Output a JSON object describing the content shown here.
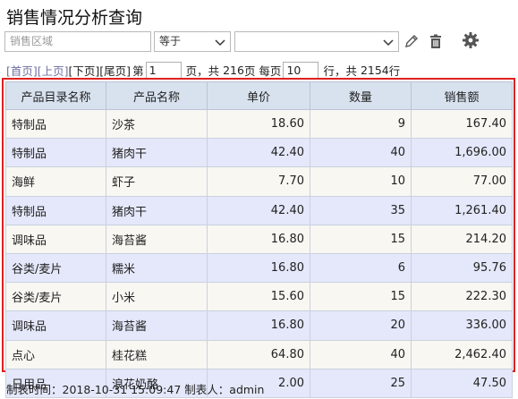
{
  "title": "销售情况分析查询",
  "filter": {
    "region_placeholder": "销售区域",
    "operator": "等于",
    "value": ""
  },
  "icons": {
    "edit": "pencil-icon",
    "delete": "trash-icon",
    "settings": "gear-icon"
  },
  "pager": {
    "first": "[首页]",
    "prev": "[上页]",
    "next": "[下页]",
    "last": "[尾页]",
    "page_prefix": "第",
    "page": "1",
    "page_suffix": "页，共",
    "total_pages": "216",
    "per_page_label": "页 每页",
    "per_page": "10",
    "rows_label": "行，共",
    "total_rows": "2154",
    "rows_unit": "行"
  },
  "table": {
    "columns": [
      "产品目录名称",
      "产品名称",
      "单价",
      "数量",
      "销售额"
    ],
    "rows": [
      [
        "特制品",
        "沙茶",
        "18.60",
        "9",
        "167.40"
      ],
      [
        "特制品",
        "猪肉干",
        "42.40",
        "40",
        "1,696.00"
      ],
      [
        "海鲜",
        "虾子",
        "7.70",
        "10",
        "77.00"
      ],
      [
        "特制品",
        "猪肉干",
        "42.40",
        "35",
        "1,261.40"
      ],
      [
        "调味品",
        "海苔酱",
        "16.80",
        "15",
        "214.20"
      ],
      [
        "谷类/麦片",
        "糯米",
        "16.80",
        "6",
        "95.76"
      ],
      [
        "谷类/麦片",
        "小米",
        "15.60",
        "15",
        "222.30"
      ],
      [
        "调味品",
        "海苔酱",
        "16.80",
        "20",
        "336.00"
      ],
      [
        "点心",
        "桂花糕",
        "64.80",
        "40",
        "2,462.40"
      ],
      [
        "日用品",
        "浪花奶酪",
        "2.00",
        "25",
        "47.50"
      ]
    ]
  },
  "footer": {
    "time_label": "制表时间：",
    "time": "2018-10-31 15:09:47",
    "maker_label": "制表人：",
    "maker": "admin"
  }
}
